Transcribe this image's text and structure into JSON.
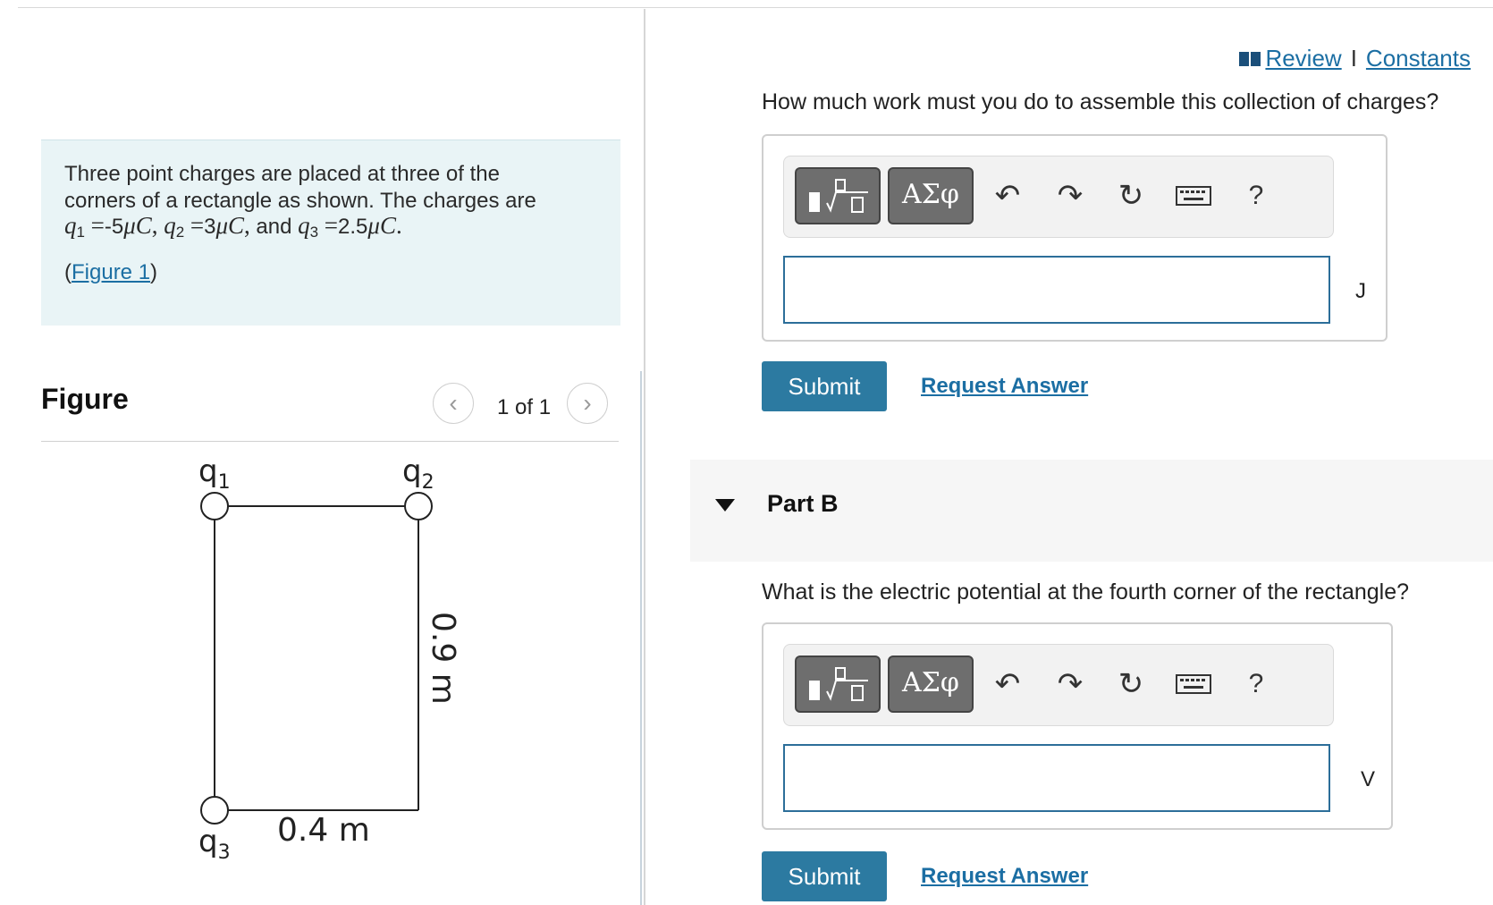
{
  "problem": {
    "line1": "Three point charges are placed at three of the",
    "line2": "corners of a rectangle as shown.  The charges are",
    "q1_label": "q",
    "q1_sub": "1",
    "q1_value": "-5",
    "q2_label": "q",
    "q2_sub": "2",
    "q2_value": "3",
    "q3_label": "q",
    "q3_sub": "3",
    "q3_value": "2.5",
    "unit": "μC",
    "and_text": "and",
    "figure_link_open": "(",
    "figure_link": "Figure 1",
    "figure_link_close": ")"
  },
  "figure": {
    "title": "Figure",
    "pager_label": "1 of 1",
    "prev_icon": "chevron-left-icon",
    "next_icon": "chevron-right-icon",
    "labels": {
      "q1": "q",
      "q1_sub": "1",
      "q2": "q",
      "q2_sub": "2",
      "q3": "q",
      "q3_sub": "3",
      "width": "0.4 m",
      "height": "0.9 m"
    }
  },
  "header": {
    "review": "Review",
    "separator": "I",
    "constants": "Constants"
  },
  "partA": {
    "question": "How much work must you do to assemble this collection of charges?",
    "toolbar": {
      "templates_icon": "fraction-sqrt-icon",
      "greek_label": "ΑΣφ",
      "undo_icon": "undo-icon",
      "redo_icon": "redo-icon",
      "reset_icon": "reset-icon",
      "keyboard_icon": "keyboard-icon",
      "help_label": "?"
    },
    "input_value": "",
    "unit": "J",
    "submit": "Submit",
    "request_answer": "Request Answer"
  },
  "partB": {
    "title": "Part B",
    "question": "What is the electric potential at the fourth corner of the rectangle?",
    "toolbar": {
      "templates_icon": "fraction-sqrt-icon",
      "greek_label": "ΑΣφ",
      "undo_icon": "undo-icon",
      "redo_icon": "redo-icon",
      "reset_icon": "reset-icon",
      "keyboard_icon": "keyboard-icon",
      "help_label": "?"
    },
    "input_value": "",
    "unit": "V",
    "submit": "Submit",
    "request_answer": "Request Answer"
  },
  "colors": {
    "accent": "#2c7aa1",
    "link": "#1b6ea3",
    "problem_bg": "#e9f4f6"
  }
}
